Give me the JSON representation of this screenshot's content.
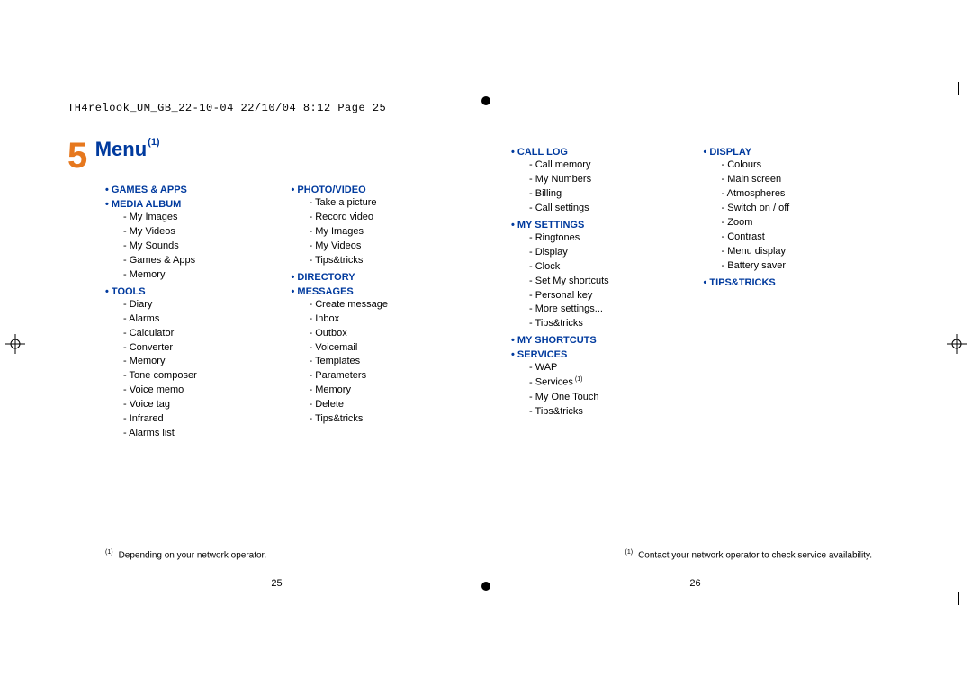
{
  "header_slug": "TH4relook_UM_GB_22-10-04  22/10/04  8:12  Page 25",
  "chapter": {
    "number": "5",
    "title": "Menu",
    "sup": "(1)"
  },
  "columns": {
    "left1": [
      {
        "head": "GAMES & APPS",
        "items": []
      },
      {
        "head": "MEDIA ALBUM",
        "items": [
          "My Images",
          "My Videos",
          "My Sounds",
          "Games & Apps",
          "Memory"
        ]
      },
      {
        "head": "TOOLS",
        "items": [
          "Diary",
          "Alarms",
          "Calculator",
          "Converter",
          "Memory",
          "Tone composer",
          "Voice memo",
          "Voice tag",
          "Infrared",
          "Alarms list"
        ]
      }
    ],
    "left2": [
      {
        "head": "PHOTO/VIDEO",
        "items": [
          "Take a picture",
          "Record video",
          "My Images",
          "My Videos",
          "Tips&tricks"
        ]
      },
      {
        "head": "DIRECTORY",
        "items": []
      },
      {
        "head": "MESSAGES",
        "items": [
          "Create message",
          "Inbox",
          "Outbox",
          "Voicemail",
          "Templates",
          "Parameters",
          "Memory",
          "Delete",
          "Tips&tricks"
        ]
      }
    ],
    "right1": [
      {
        "head": "CALL LOG",
        "items": [
          "Call memory",
          "My Numbers",
          "Billing",
          "Call settings"
        ]
      },
      {
        "head": "MY SETTINGS",
        "items": [
          "Ringtones",
          "Display",
          "Clock",
          "Set My shortcuts",
          "Personal key",
          "More settings...",
          "Tips&tricks"
        ]
      },
      {
        "head": "MY SHORTCUTS",
        "items": []
      },
      {
        "head": "SERVICES",
        "items": [
          "WAP",
          {
            "text": "Services",
            "sup": "(1)"
          },
          "My One Touch",
          "Tips&tricks"
        ]
      }
    ],
    "right2": [
      {
        "head": "DISPLAY",
        "items": [
          "Colours",
          "Main screen",
          "Atmospheres",
          "Switch on / off",
          "Zoom",
          "Contrast",
          "Menu display",
          "Battery saver"
        ]
      },
      {
        "head": "TIPS&TRICKS",
        "items": []
      }
    ]
  },
  "footnote_left": {
    "marker": "(1)",
    "text": "Depending on your network operator."
  },
  "footnote_right": {
    "marker": "(1)",
    "text": "Contact your network operator to check service availability."
  },
  "pagenum_left": "25",
  "pagenum_right": "26"
}
